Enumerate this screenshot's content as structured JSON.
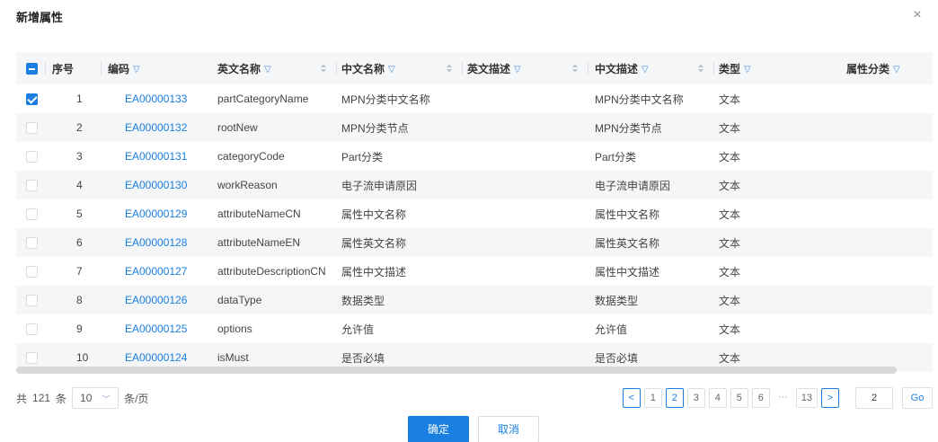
{
  "dialog": {
    "title": "新增属性",
    "close_glyph": "×"
  },
  "table": {
    "header_checkbox": "indeterminate",
    "columns": {
      "index": "序号",
      "code": "编码",
      "en_name": "英文名称",
      "cn_name": "中文名称",
      "en_desc": "英文描述",
      "cn_desc": "中文描述",
      "type": "类型",
      "category": "属性分类"
    },
    "rows": [
      {
        "checked": true,
        "index": "1",
        "code": "EA00000133",
        "en_name": "partCategoryName",
        "cn_name": "MPN分类中文名称",
        "en_desc": "",
        "cn_desc": "MPN分类中文名称",
        "type": "文本",
        "category": ""
      },
      {
        "checked": false,
        "index": "2",
        "code": "EA00000132",
        "en_name": "rootNew",
        "cn_name": "MPN分类节点",
        "en_desc": "",
        "cn_desc": "MPN分类节点",
        "type": "文本",
        "category": ""
      },
      {
        "checked": false,
        "index": "3",
        "code": "EA00000131",
        "en_name": "categoryCode",
        "cn_name": "Part分类",
        "en_desc": "",
        "cn_desc": "Part分类",
        "type": "文本",
        "category": ""
      },
      {
        "checked": false,
        "index": "4",
        "code": "EA00000130",
        "en_name": "workReason",
        "cn_name": "电子流申请原因",
        "en_desc": "",
        "cn_desc": "电子流申请原因",
        "type": "文本",
        "category": ""
      },
      {
        "checked": false,
        "index": "5",
        "code": "EA00000129",
        "en_name": "attributeNameCN",
        "cn_name": "属性中文名称",
        "en_desc": "",
        "cn_desc": "属性中文名称",
        "type": "文本",
        "category": ""
      },
      {
        "checked": false,
        "index": "6",
        "code": "EA00000128",
        "en_name": "attributeNameEN",
        "cn_name": "属性英文名称",
        "en_desc": "",
        "cn_desc": "属性英文名称",
        "type": "文本",
        "category": ""
      },
      {
        "checked": false,
        "index": "7",
        "code": "EA00000127",
        "en_name": "attributeDescriptionCN",
        "cn_name": "属性中文描述",
        "en_desc": "",
        "cn_desc": "属性中文描述",
        "type": "文本",
        "category": ""
      },
      {
        "checked": false,
        "index": "8",
        "code": "EA00000126",
        "en_name": "dataType",
        "cn_name": "数据类型",
        "en_desc": "",
        "cn_desc": "数据类型",
        "type": "文本",
        "category": ""
      },
      {
        "checked": false,
        "index": "9",
        "code": "EA00000125",
        "en_name": "options",
        "cn_name": "允许值",
        "en_desc": "",
        "cn_desc": "允许值",
        "type": "文本",
        "category": ""
      },
      {
        "checked": false,
        "index": "10",
        "code": "EA00000124",
        "en_name": "isMust",
        "cn_name": "是否必填",
        "en_desc": "",
        "cn_desc": "是否必填",
        "type": "文本",
        "category": ""
      }
    ]
  },
  "pagination": {
    "total_prefix": "共",
    "total": "121",
    "total_suffix": "条",
    "page_size": "10",
    "page_size_suffix": "条/页",
    "prev_glyph": "<",
    "next_glyph": ">",
    "pages": [
      "1",
      "2",
      "3",
      "4",
      "5",
      "6",
      "···",
      "13"
    ],
    "current_page": "2",
    "jump_value": "2",
    "go_label": "Go"
  },
  "footer": {
    "confirm_label": "确定",
    "cancel_label": "取消"
  },
  "colors": {
    "accent": "#1a7fe0",
    "stripe": "#f5f6f8",
    "header_bg": "#f5f6f8"
  }
}
